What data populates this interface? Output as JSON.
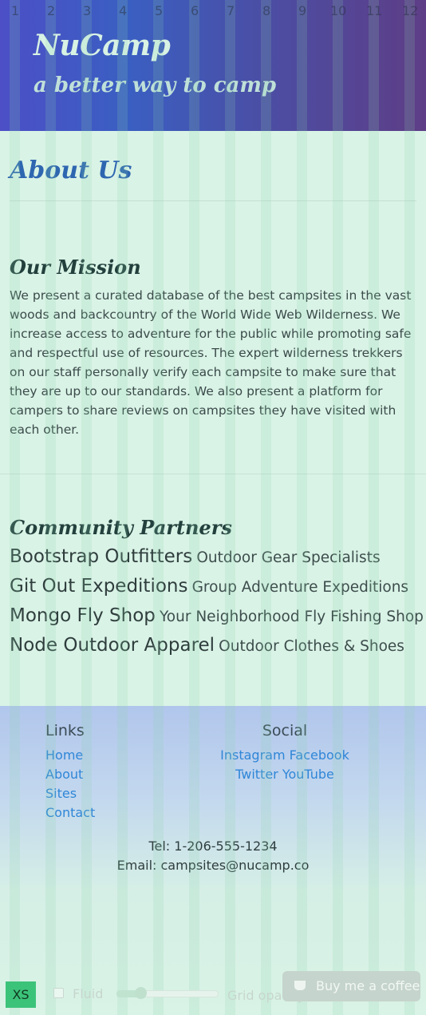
{
  "header": {
    "brand": "NuCamp",
    "tagline": "a better way to camp"
  },
  "main": {
    "title": "About Us",
    "mission": {
      "title": "Our Mission",
      "text": "We present a curated database of the best campsites in the vast woods and backcountry of the World Wide Web Wilderness. We increase access to adventure for the public while promoting safe and respectful use of resources. The expert wilderness trekkers on our staff personally verify each campsite to make sure that they are up to our standards. We also present a platform for campers to share reviews on campsites they have visited with each other."
    },
    "partners": {
      "title": "Community Partners",
      "items": [
        {
          "name": "Bootstrap Outfitters",
          "desc": "Outdoor Gear Specialists"
        },
        {
          "name": "Git Out Expeditions",
          "desc": "Group Adventure Expeditions"
        },
        {
          "name": "Mongo Fly Shop",
          "desc": "Your Neighborhood Fly Fishing Shop"
        },
        {
          "name": "Node Outdoor Apparel",
          "desc": "Outdoor Clothes & Shoes"
        }
      ]
    }
  },
  "footer": {
    "links_heading": "Links",
    "links": [
      "Home",
      "About",
      "Sites",
      "Contact"
    ],
    "social_heading": "Social",
    "social": [
      "Instagram",
      "Facebook",
      "Twitter",
      "YouTube"
    ],
    "tel": "Tel: 1-206-555-1234",
    "email": "Email: campsites@nucamp.co"
  },
  "grid_overlay": {
    "columns": [
      "1",
      "2",
      "3",
      "4",
      "5",
      "6",
      "7",
      "8",
      "9",
      "10",
      "11",
      "12"
    ],
    "breakpoint": "XS",
    "fluid_label": "Fluid",
    "fluid_checked": false,
    "opacity_label": "Grid opacity",
    "opacity_value": 0.25
  },
  "coffee_button": {
    "label": "Buy me a coffee",
    "icon": "coffee-cup-icon"
  },
  "colors": {
    "page_bg": "#d9f3e6",
    "title": "#2e66b0",
    "link": "#2f86d8",
    "badge": "#3cc37a"
  }
}
